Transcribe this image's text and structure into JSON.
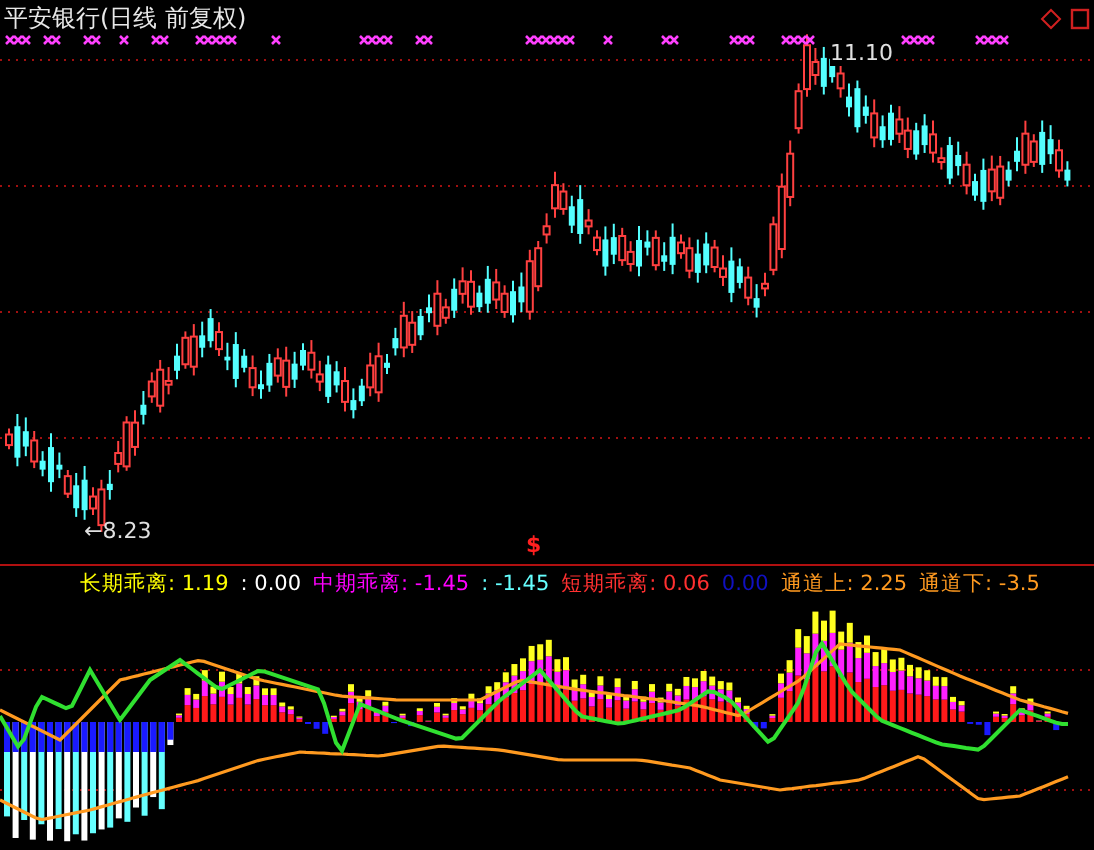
{
  "chart": {
    "title": "平安银行(日线 前复权)",
    "high_label": "11.10",
    "low_label": "←8.23",
    "signal_marker": "$"
  },
  "indicator": {
    "legend": [
      {
        "label": "长期乖离:",
        "value": "1.19",
        "color": "#ffff00"
      },
      {
        "label": ":",
        "value": "0.00",
        "color": "#ffffff"
      },
      {
        "label": "中期乖离:",
        "value": "-1.45",
        "color": "#ff00ff"
      },
      {
        "label": ":",
        "value": "-1.45",
        "color": "#66ffff"
      },
      {
        "label": "短期乖离:",
        "value": "0.06",
        "color": "#ff3030"
      },
      {
        "value": "0.00",
        "color": "#1010c0"
      },
      {
        "label": "通道上:",
        "value": "2.25",
        "color": "#ff9a20"
      },
      {
        "label": "通道下:",
        "value": "-3.5",
        "color": "#ff9a20"
      }
    ]
  }
}
